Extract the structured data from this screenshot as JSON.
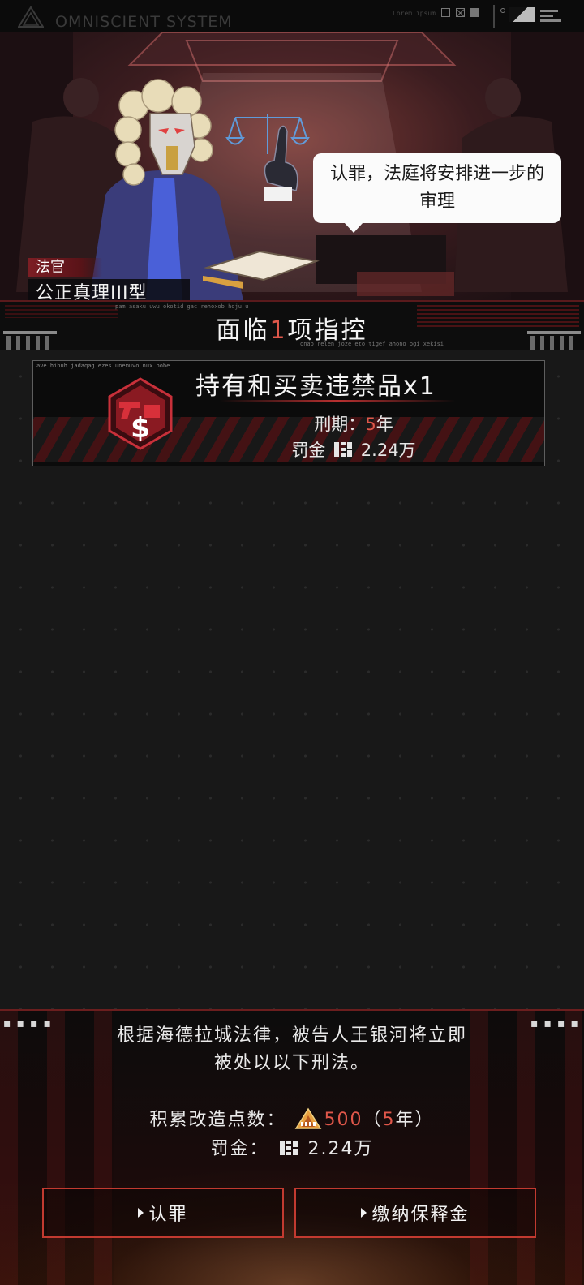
{
  "top_bar": {
    "system_title": "OMNISCIENT SYSTEM",
    "lorem": "Lorem ipsum"
  },
  "scene": {
    "speech": "认罪，法庭将安排进一步的审理",
    "role": "法官",
    "name": "公正真理III型"
  },
  "charges_header": {
    "prefix": "面临",
    "count": "1",
    "suffix": "项指控",
    "tiny_top": "pam asaku uwu okotid gac rehoxob hoju u",
    "tiny_bottom": "onap relen joze eto tigef ahono ogi xekisi"
  },
  "charge_card": {
    "tiny": "ave hibuh jadaqag ezes unemuvo nux bobe",
    "crime": "持有和买卖违禁品x1",
    "sentence_label": "刑期：",
    "sentence_value": "5",
    "sentence_unit": "年",
    "fine_label": "罚金",
    "fine_value": "2.24万",
    "icon": "contraband-emblem-icon"
  },
  "bottom_panel": {
    "verdict_line1": "根据海德拉城法律，被告人王银河将立即",
    "verdict_line2": "被处以以下刑法。",
    "points_label": "积累改造点数：",
    "points_value": "500",
    "points_paren_open": "（",
    "points_years": "5",
    "points_years_unit": "年）",
    "fine_label": "罚金：",
    "fine_value": "2.24万",
    "dots": "▪▪▪▪"
  },
  "buttons": {
    "plead_guilty": "认罪",
    "pay_bail": "缴纳保释金"
  },
  "colors": {
    "accent_red": "#e0574a",
    "button_border": "#c23a30",
    "background": "#181818"
  }
}
